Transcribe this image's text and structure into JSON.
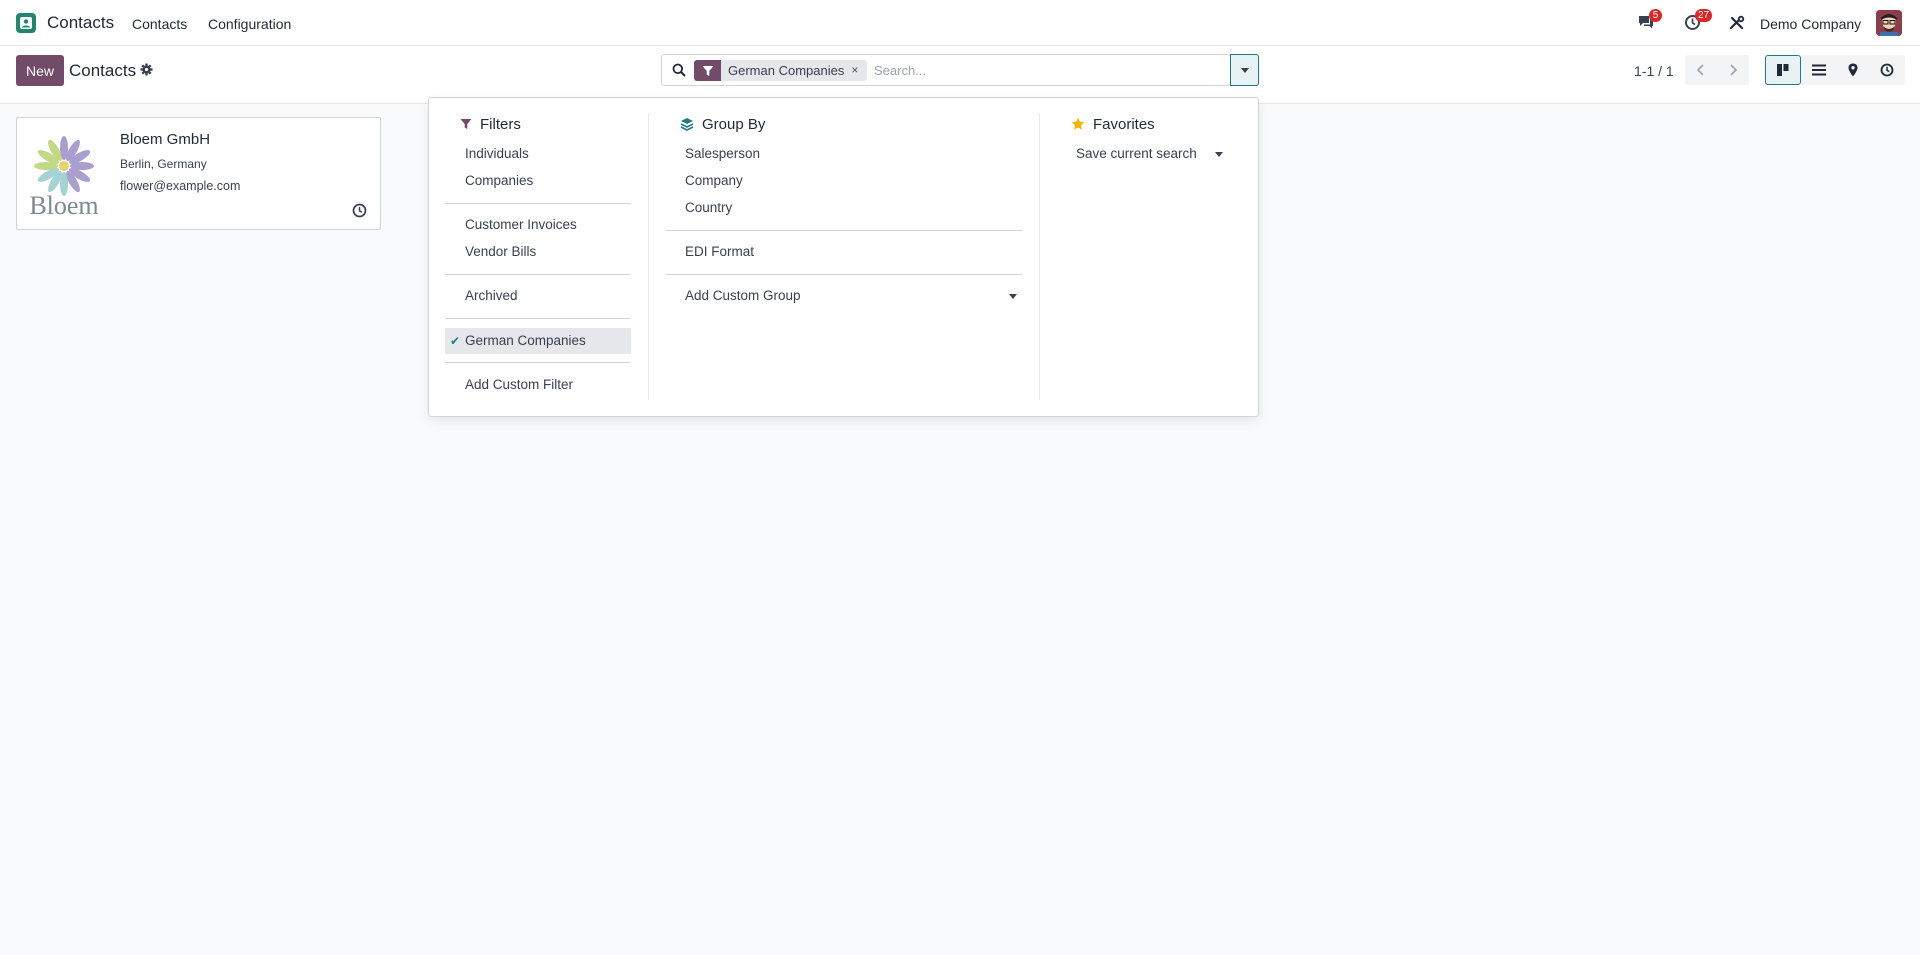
{
  "navbar": {
    "app_name": "Contacts",
    "menu": [
      {
        "label": "Contacts"
      },
      {
        "label": "Configuration"
      }
    ],
    "messages_badge": "5",
    "activities_badge": "27",
    "company": "Demo Company"
  },
  "control_panel": {
    "new_label": "New",
    "title": "Contacts",
    "search": {
      "facet_value": "German Companies",
      "facet_close": "×",
      "placeholder": "Search..."
    },
    "pager": "1-1 / 1"
  },
  "records": [
    {
      "name": "Bloem GmbH",
      "location": "Berlin, Germany",
      "email": "flower@example.com",
      "logo_text": "Bloem"
    }
  ],
  "dropdown": {
    "filters": {
      "title": "Filters",
      "items": [
        {
          "label": "Individuals"
        },
        {
          "label": "Companies"
        },
        {
          "label": "Customer Invoices"
        },
        {
          "label": "Vendor Bills"
        },
        {
          "label": "Archived"
        },
        {
          "label": "German Companies",
          "selected": true
        },
        {
          "label": "Add Custom Filter"
        }
      ],
      "check_glyph": "✔"
    },
    "group_by": {
      "title": "Group By",
      "items": [
        {
          "label": "Salesperson"
        },
        {
          "label": "Company"
        },
        {
          "label": "Country"
        },
        {
          "label": "EDI Format"
        },
        {
          "label": "Add Custom Group"
        }
      ]
    },
    "favorites": {
      "title": "Favorites",
      "items": [
        {
          "label": "Save current search"
        }
      ]
    }
  },
  "colors": {
    "primary": "#714b67",
    "accent": "#1f7c86",
    "app_icon": "#21866f",
    "badge": "#dc2626",
    "star": "#f3b500"
  },
  "icons": [
    "app-logo-icon",
    "chat-icon",
    "clock-icon",
    "tools-icon",
    "gear-icon",
    "search-icon",
    "filter-icon",
    "caret-down-icon",
    "chevron-left-icon",
    "chevron-right-icon",
    "kanban-view-icon",
    "list-view-icon",
    "map-view-icon",
    "activity-view-icon",
    "layers-icon",
    "star-icon",
    "check-icon"
  ]
}
